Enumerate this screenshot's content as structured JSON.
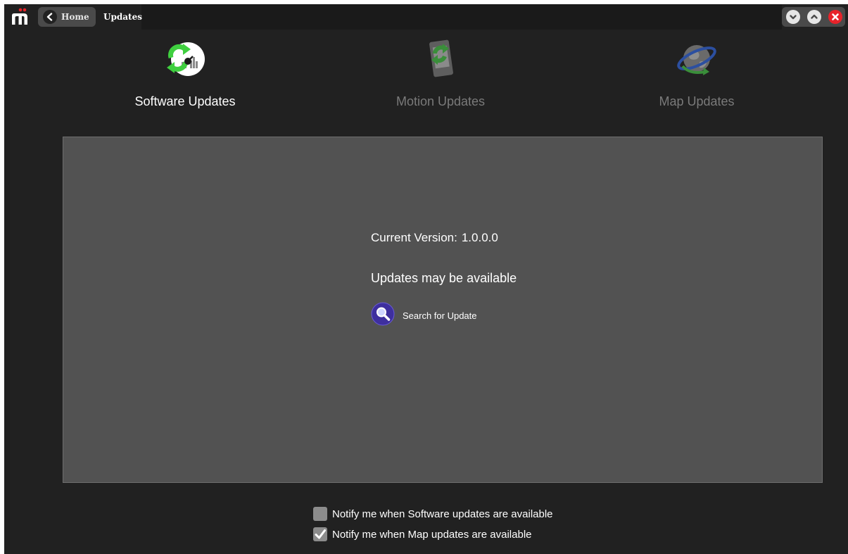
{
  "titlebar": {
    "home_label": "Home",
    "page_title": "Updates"
  },
  "tabs": [
    {
      "label": "Software Updates",
      "icon": "software-update-icon",
      "active": true
    },
    {
      "label": "Motion Updates",
      "icon": "motion-update-icon",
      "active": false
    },
    {
      "label": "Map Updates",
      "icon": "map-update-icon",
      "active": false
    }
  ],
  "panel": {
    "current_version_label": "Current Version:",
    "current_version_value": "1.0.0.0",
    "status_text": "Updates may be available",
    "search_label": "Search for Update"
  },
  "options": [
    {
      "label": "Notify me when Software updates are available",
      "checked": false
    },
    {
      "label": "Notify me when Map updates are available",
      "checked": true
    }
  ],
  "colors": {
    "background": "#212121",
    "panel": "#525252",
    "active_text": "#ffffff",
    "inactive_text": "#7a7a7a",
    "close_red": "#e8232a",
    "search_purple": "#3e2f9e"
  }
}
